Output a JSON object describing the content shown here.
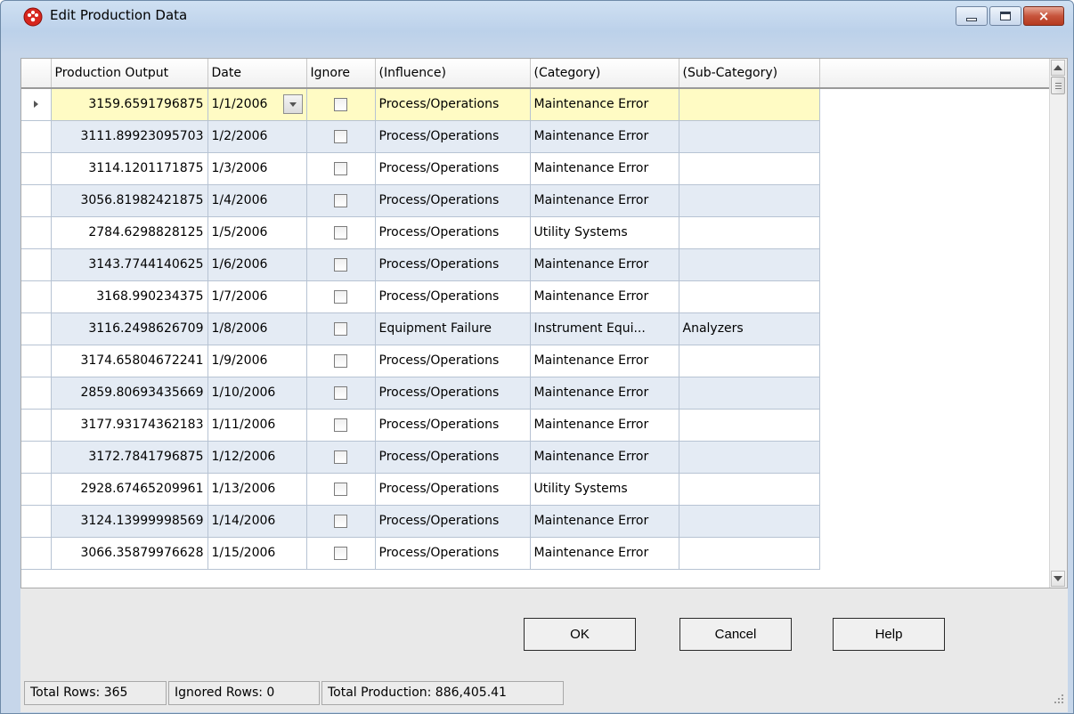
{
  "window": {
    "title": "Edit Production Data",
    "icon": "app-red-gear-icon",
    "buttons": {
      "minimize": "minimize-icon",
      "maximize": "maximize-icon",
      "close": "×"
    }
  },
  "grid": {
    "columns": [
      "Production Output",
      "Date",
      "Ignore",
      "(Influence)",
      "(Category)",
      "(Sub-Category)"
    ],
    "rows": [
      {
        "output": "3159.6591796875",
        "date": "1/1/2006",
        "ignore": false,
        "influence": "Process/Operations",
        "category": "Maintenance Error",
        "subcategory": ""
      },
      {
        "output": "3111.89923095703",
        "date": "1/2/2006",
        "ignore": false,
        "influence": "Process/Operations",
        "category": "Maintenance Error",
        "subcategory": ""
      },
      {
        "output": "3114.1201171875",
        "date": "1/3/2006",
        "ignore": false,
        "influence": "Process/Operations",
        "category": "Maintenance Error",
        "subcategory": ""
      },
      {
        "output": "3056.81982421875",
        "date": "1/4/2006",
        "ignore": false,
        "influence": "Process/Operations",
        "category": "Maintenance Error",
        "subcategory": ""
      },
      {
        "output": "2784.6298828125",
        "date": "1/5/2006",
        "ignore": false,
        "influence": "Process/Operations",
        "category": "Utility Systems",
        "subcategory": ""
      },
      {
        "output": "3143.7744140625",
        "date": "1/6/2006",
        "ignore": false,
        "influence": "Process/Operations",
        "category": "Maintenance Error",
        "subcategory": ""
      },
      {
        "output": "3168.990234375",
        "date": "1/7/2006",
        "ignore": false,
        "influence": "Process/Operations",
        "category": "Maintenance Error",
        "subcategory": ""
      },
      {
        "output": "3116.2498626709",
        "date": "1/8/2006",
        "ignore": false,
        "influence": "Equipment Failure",
        "category": "Instrument Equi...",
        "subcategory": "Analyzers"
      },
      {
        "output": "3174.65804672241",
        "date": "1/9/2006",
        "ignore": false,
        "influence": "Process/Operations",
        "category": "Maintenance Error",
        "subcategory": ""
      },
      {
        "output": "2859.80693435669",
        "date": "1/10/2006",
        "ignore": false,
        "influence": "Process/Operations",
        "category": "Maintenance Error",
        "subcategory": ""
      },
      {
        "output": "3177.93174362183",
        "date": "1/11/2006",
        "ignore": false,
        "influence": "Process/Operations",
        "category": "Maintenance Error",
        "subcategory": ""
      },
      {
        "output": "3172.7841796875",
        "date": "1/12/2006",
        "ignore": false,
        "influence": "Process/Operations",
        "category": "Maintenance Error",
        "subcategory": ""
      },
      {
        "output": "2928.67465209961",
        "date": "1/13/2006",
        "ignore": false,
        "influence": "Process/Operations",
        "category": "Utility Systems",
        "subcategory": ""
      },
      {
        "output": "3124.13999998569",
        "date": "1/14/2006",
        "ignore": false,
        "influence": "Process/Operations",
        "category": "Maintenance Error",
        "subcategory": ""
      },
      {
        "output": "3066.35879976628",
        "date": "1/15/2006",
        "ignore": false,
        "influence": "Process/Operations",
        "category": "Maintenance Error",
        "subcategory": ""
      }
    ],
    "current_row_marker": "row-selector-arrow-icon"
  },
  "buttons": {
    "ok": "OK",
    "cancel": "Cancel",
    "help": "Help"
  },
  "status": {
    "total_rows": "Total Rows: 365",
    "ignored_rows": "Ignored Rows: 0",
    "total_production": "Total Production: 886,405.41"
  },
  "colors": {
    "current_row": "#fffbc4",
    "alt_row": "#e4ebf4",
    "close_button": "#c7543c"
  }
}
